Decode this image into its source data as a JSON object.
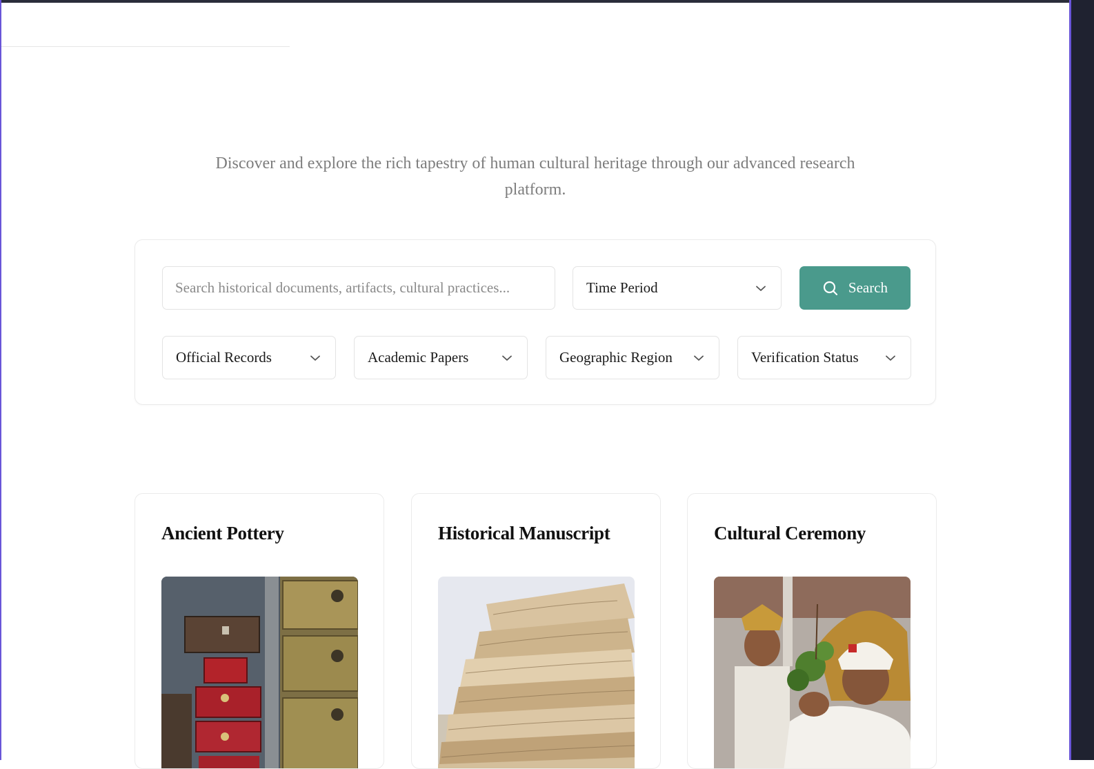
{
  "hero": {
    "subtitle": "Discover and explore the rich tapestry of human cultural heritage through our advanced research platform."
  },
  "search": {
    "placeholder": "Search historical documents, artifacts, cultural practices...",
    "time_period_label": "Time Period",
    "button_label": "Search"
  },
  "filters": [
    {
      "label": "Official Records"
    },
    {
      "label": "Academic Papers"
    },
    {
      "label": "Geographic Region"
    },
    {
      "label": "Verification Status"
    }
  ],
  "cards": [
    {
      "title": "Ancient Pottery"
    },
    {
      "title": "Historical Manuscript"
    },
    {
      "title": "Cultural Ceremony"
    }
  ],
  "colors": {
    "accent": "#4a9a8c",
    "frame_accent": "#6a56d8"
  },
  "icons": {
    "search": "search-icon",
    "dropdown": "chevron-down-icon"
  }
}
